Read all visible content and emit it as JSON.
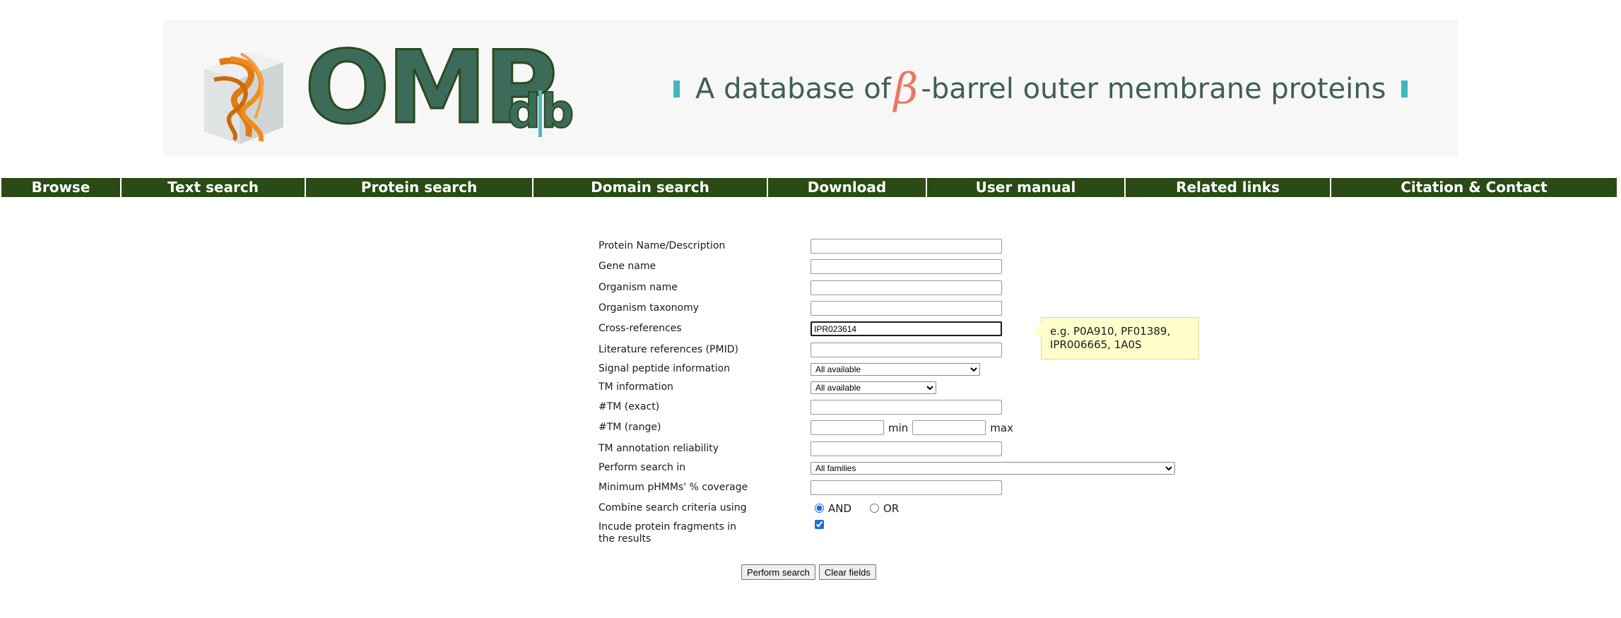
{
  "header": {
    "logo_main": "OMP",
    "logo_sub": "db",
    "tagline_prefix": "A database of",
    "tagline_beta": "β",
    "tagline_suffix": "-barrel outer membrane proteins",
    "colors": {
      "logo": "#3d6b5a",
      "accent": "#3fb6c0",
      "beta": "#e8795e"
    }
  },
  "nav": {
    "items": [
      {
        "label": "Browse"
      },
      {
        "label": "Text search"
      },
      {
        "label": "Protein search"
      },
      {
        "label": "Domain search"
      },
      {
        "label": "Download"
      },
      {
        "label": "User manual"
      },
      {
        "label": "Related links"
      },
      {
        "label": "Citation & Contact"
      }
    ],
    "color": "#2a4a16"
  },
  "form": {
    "protein_name": {
      "label": "Protein Name/Description",
      "value": ""
    },
    "gene_name": {
      "label": "Gene name",
      "value": ""
    },
    "organism_name": {
      "label": "Organism name",
      "value": ""
    },
    "organism_taxonomy": {
      "label": "Organism taxonomy",
      "value": ""
    },
    "cross_references": {
      "label": "Cross-references",
      "value": "IPR023614"
    },
    "literature_references": {
      "label": "Literature references (PMID)",
      "value": ""
    },
    "signal_peptide": {
      "label": "Signal peptide information",
      "selected": "All available"
    },
    "tm_information": {
      "label": "TM information",
      "selected": "All available"
    },
    "tm_exact": {
      "label": "#TM (exact)",
      "value": ""
    },
    "tm_range": {
      "label": "#TM (range)",
      "min_value": "",
      "max_value": "",
      "min_label": "min",
      "max_label": "max"
    },
    "tm_reliability": {
      "label": "TM annotation reliability",
      "value": ""
    },
    "search_in": {
      "label": "Perform search in",
      "selected": "All families"
    },
    "min_coverage": {
      "label": "Minimum pHMMs' % coverage",
      "value": ""
    },
    "combine": {
      "label": "Combine search criteria using",
      "and_label": "AND",
      "or_label": "OR",
      "selected": "AND"
    },
    "include_fragments": {
      "label": "Incude protein fragments in the results",
      "checked": true
    }
  },
  "tooltip": {
    "text": "e.g. P0A910, PF01389, IPR006665, 1A0S"
  },
  "buttons": {
    "perform_search": "Perform search",
    "clear_fields": "Clear fields"
  }
}
